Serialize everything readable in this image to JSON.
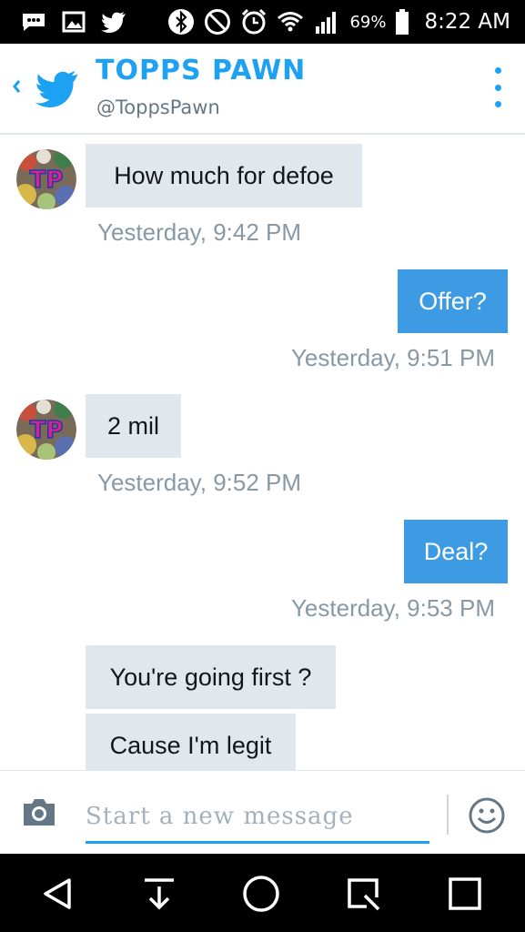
{
  "status_bar": {
    "battery_percent": "69%",
    "time": "8:22 AM",
    "icons": [
      "message-icon",
      "image-icon",
      "twitter-icon",
      "bluetooth-icon",
      "do-not-disturb-icon",
      "alarm-icon",
      "wifi-icon",
      "signal-icon",
      "battery-icon"
    ]
  },
  "header": {
    "title": "TOPPS PAWN",
    "handle": "@ToppsPawn"
  },
  "messages": [
    {
      "direction": "in",
      "text": "How much for defoe",
      "time": "Yesterday, 9:42 PM"
    },
    {
      "direction": "out",
      "text": "Offer?",
      "time": "Yesterday, 9:51 PM"
    },
    {
      "direction": "in",
      "text": "2 mil",
      "time": "Yesterday, 9:52 PM"
    },
    {
      "direction": "out",
      "text": "Deal?",
      "time": "Yesterday, 9:53 PM"
    },
    {
      "direction": "in",
      "text": "You're going first ?"
    },
    {
      "direction": "in",
      "text": "Cause I'm legit"
    }
  ],
  "avatar": {
    "initials": "TP"
  },
  "composer": {
    "placeholder": "Start a new message"
  },
  "colors": {
    "accent": "#1da1f2",
    "outgoing_bubble": "#3c9be3",
    "incoming_bubble": "#e1e8ed",
    "timestamp": "#8899a6"
  }
}
